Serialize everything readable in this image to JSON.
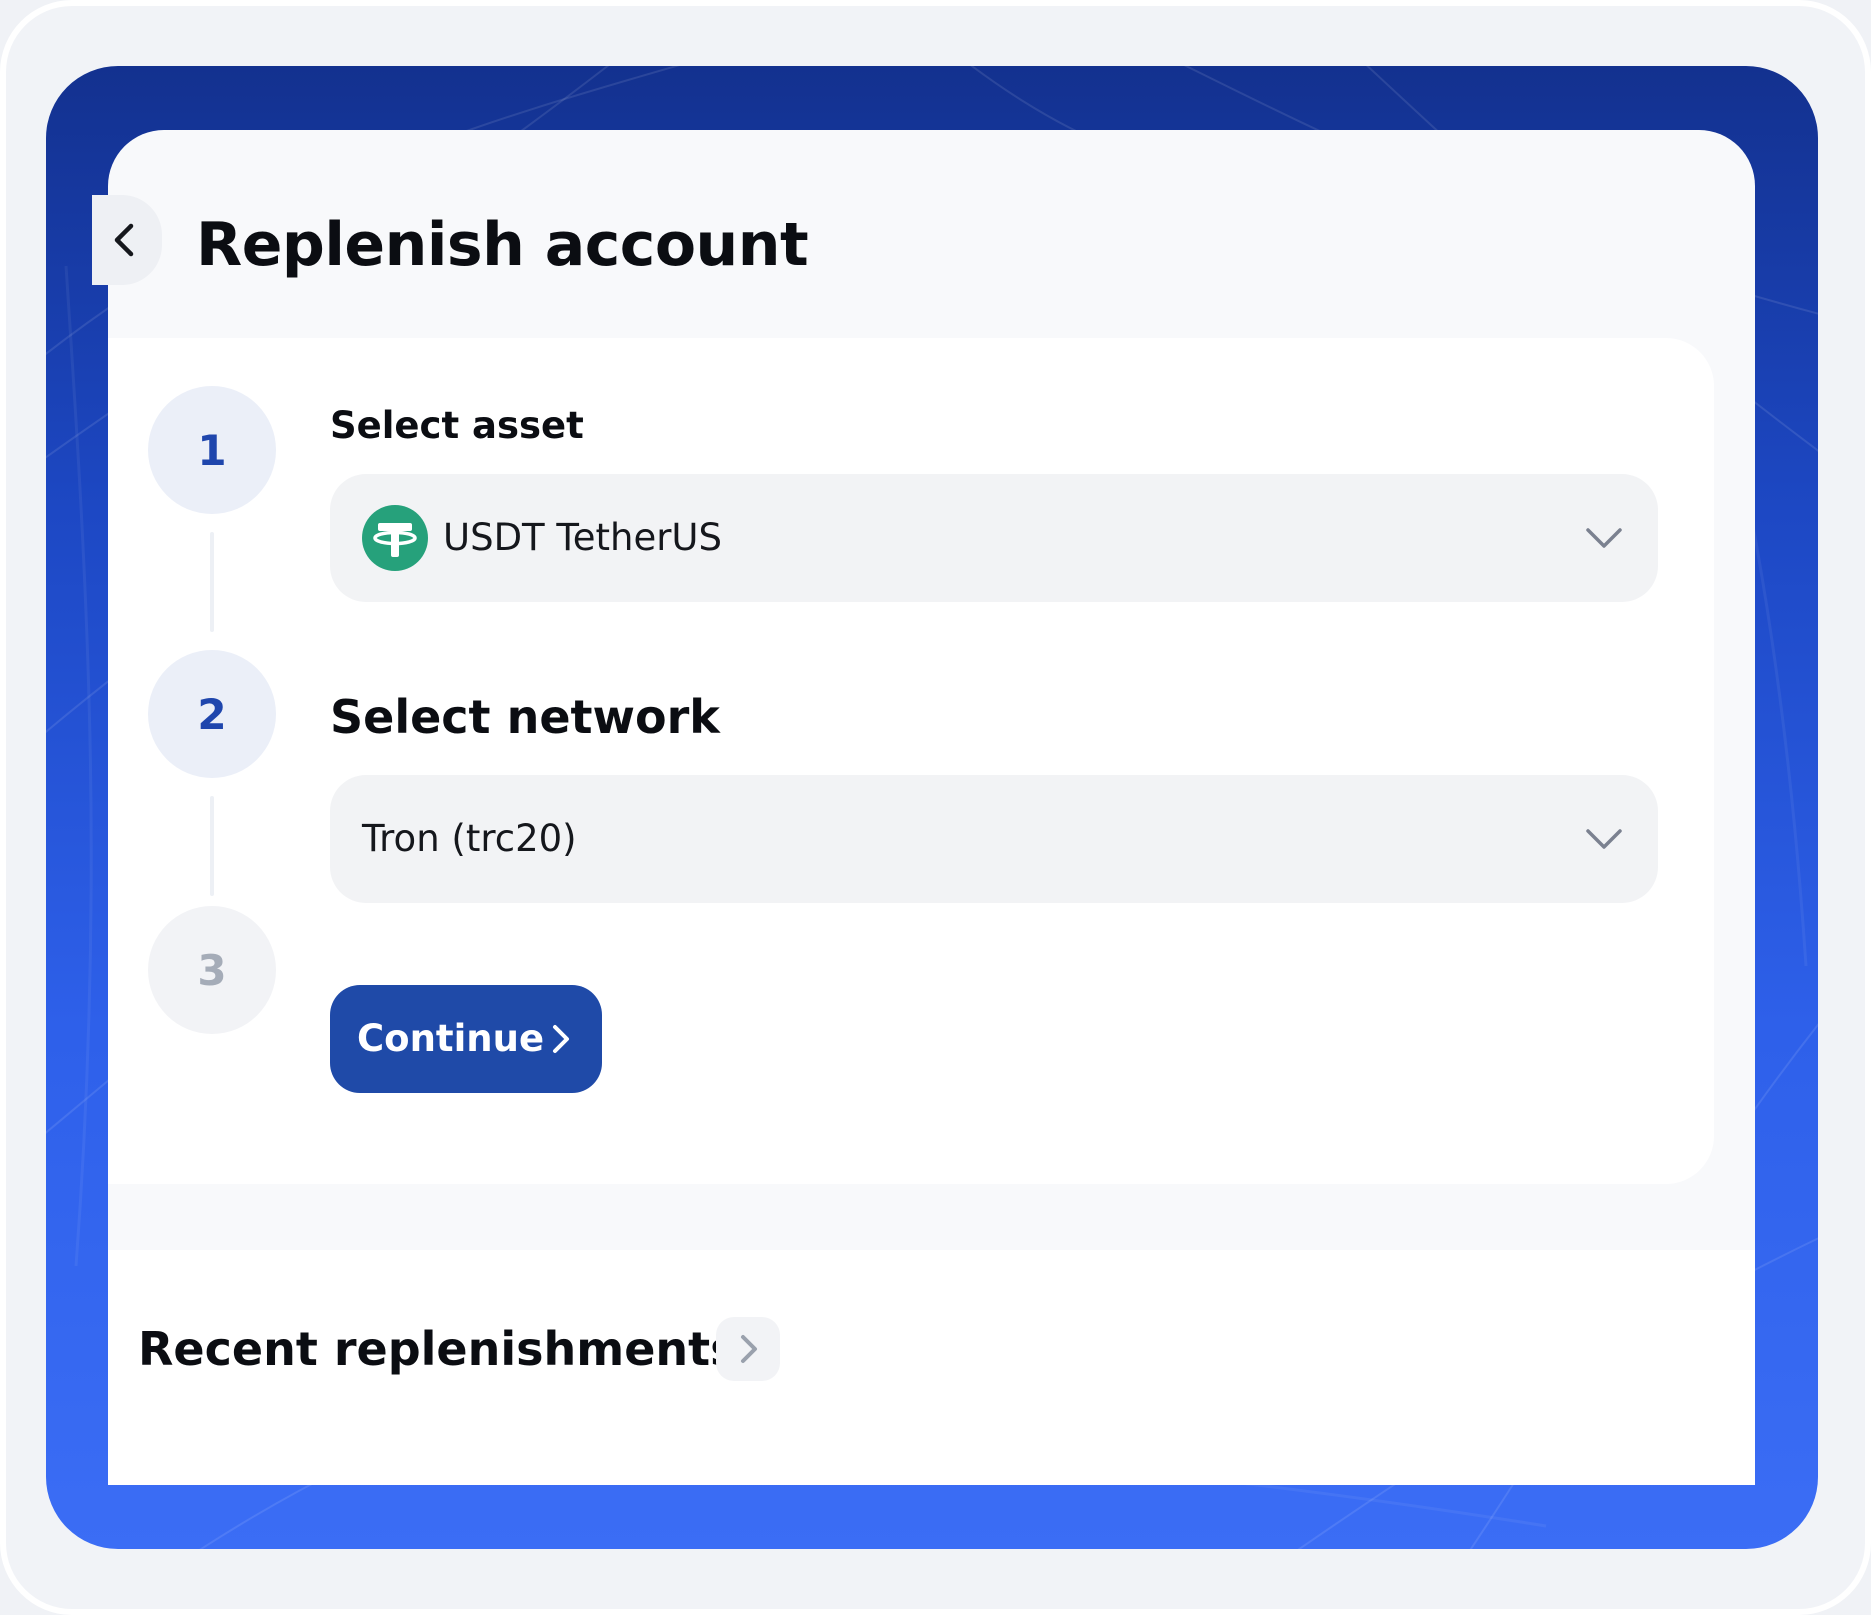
{
  "header": {
    "title": "Replenish account",
    "back_icon": "chevron-left-icon"
  },
  "steps": [
    {
      "number": "1",
      "label": "Select asset",
      "state": "active",
      "select": {
        "value": "USDT TetherUS",
        "icon": "tether-icon",
        "icon_color": "#26a17b"
      }
    },
    {
      "number": "2",
      "label": "Select network",
      "state": "active",
      "select": {
        "value": "Tron (trc20)"
      }
    },
    {
      "number": "3",
      "state": "inactive",
      "action": {
        "label": "Continue",
        "icon": "chevron-right-icon"
      }
    }
  ],
  "recent": {
    "title": "Recent replenishments",
    "arrow_icon": "chevron-right-icon"
  },
  "colors": {
    "accent": "#1f4aa8",
    "step_active_text": "#1f46ad",
    "step_inactive_text": "#a5acb8",
    "panel_gradient_top": "#13318f",
    "panel_gradient_bottom": "#3b6df5"
  }
}
